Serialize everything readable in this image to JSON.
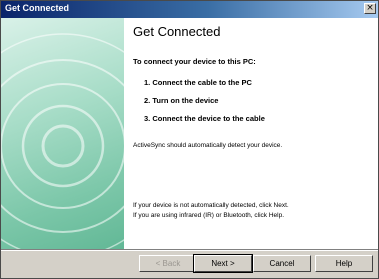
{
  "window": {
    "title": "Get Connected",
    "close_glyph": "×"
  },
  "content": {
    "heading": "Get Connected",
    "intro": "To connect your device to this PC:",
    "steps": [
      "1. Connect the cable to the PC",
      "2. Turn on the device",
      "3. Connect the device to the cable"
    ],
    "auto_detect": "ActiveSync should automatically detect your device.",
    "note_line1": "If your device is not automatically detected, click Next.",
    "note_line2": "If you are using infrared (IR) or Bluetooth, click Help."
  },
  "buttons": {
    "back": "< Back",
    "next": "Next >",
    "cancel": "Cancel",
    "help": "Help"
  },
  "colors": {
    "title_bar_start": "#0a246a",
    "title_bar_end": "#a6caf0",
    "banner_green": "#7cc7a9",
    "dialog_face": "#d4d0c8"
  }
}
